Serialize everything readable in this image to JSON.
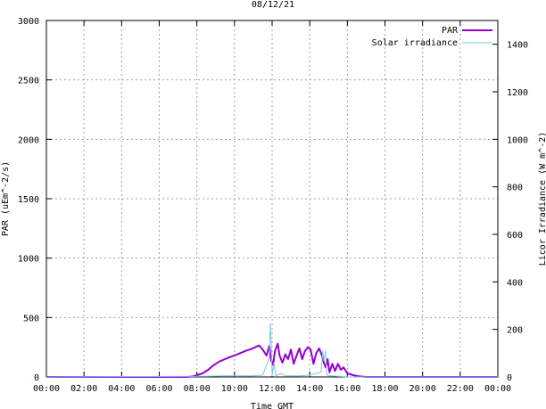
{
  "chart_data": {
    "type": "line",
    "title": "08/12/21",
    "xlabel": "Time GMT",
    "ylabel": "PAR (uEm^-2/s)",
    "y2label": "Licor Irradiance (W m^-2)",
    "x_ticks": [
      "00:00",
      "02:00",
      "04:00",
      "06:00",
      "08:00",
      "10:00",
      "12:00",
      "14:00",
      "16:00",
      "18:00",
      "20:00",
      "22:00",
      "00:00"
    ],
    "xlim_hours": [
      0,
      24
    ],
    "ylim": [
      0,
      3000
    ],
    "y_ticks": [
      "0",
      "500",
      "1000",
      "1500",
      "2000",
      "2500",
      "3000"
    ],
    "y2lim": [
      0,
      1500
    ],
    "y2_ticks": [
      "0",
      "200",
      "400",
      "600",
      "800",
      "1000",
      "1200",
      "1400"
    ],
    "grid": true,
    "legend_position": "top-right",
    "series": [
      {
        "name": "PAR",
        "axis": "left",
        "color": "#9400d3",
        "x_hours": [
          0,
          7.5,
          7.8,
          8.0,
          8.3,
          8.6,
          8.9,
          9.2,
          9.5,
          9.8,
          10.0,
          10.3,
          10.6,
          10.9,
          11.1,
          11.3,
          11.5,
          11.7,
          11.85,
          11.95,
          12.05,
          12.15,
          12.3,
          12.4,
          12.55,
          12.7,
          12.85,
          13.0,
          13.15,
          13.3,
          13.45,
          13.6,
          13.75,
          13.9,
          14.05,
          14.2,
          14.35,
          14.5,
          14.65,
          14.75,
          14.85,
          14.95,
          15.05,
          15.2,
          15.35,
          15.5,
          15.65,
          15.8,
          16.0,
          16.3,
          16.6,
          17.0,
          24
        ],
        "values": [
          0,
          0,
          5,
          15,
          30,
          60,
          100,
          130,
          150,
          170,
          180,
          200,
          220,
          235,
          250,
          265,
          230,
          180,
          260,
          140,
          100,
          220,
          280,
          180,
          120,
          190,
          150,
          230,
          110,
          180,
          240,
          150,
          220,
          250,
          230,
          110,
          200,
          240,
          180,
          120,
          80,
          150,
          40,
          110,
          50,
          110,
          60,
          80,
          30,
          15,
          5,
          0,
          0
        ]
      },
      {
        "name": "Solar irradiance",
        "axis": "right",
        "color": "#7ec8e3",
        "x_hours": [
          0,
          8.5,
          9.5,
          10.5,
          11.0,
          11.5,
          11.85,
          11.9,
          11.95,
          12.0,
          12.1,
          12.2,
          12.5,
          12.7,
          12.9,
          13.5,
          14.0,
          14.6,
          14.7,
          14.75,
          14.85,
          14.9,
          15.0,
          15.2,
          15.5,
          16.0,
          24
        ],
        "values": [
          0,
          3,
          5,
          5,
          5,
          8,
          80,
          225,
          150,
          5,
          60,
          5,
          15,
          5,
          5,
          5,
          8,
          20,
          110,
          70,
          110,
          10,
          5,
          5,
          3,
          0,
          0
        ]
      }
    ]
  }
}
